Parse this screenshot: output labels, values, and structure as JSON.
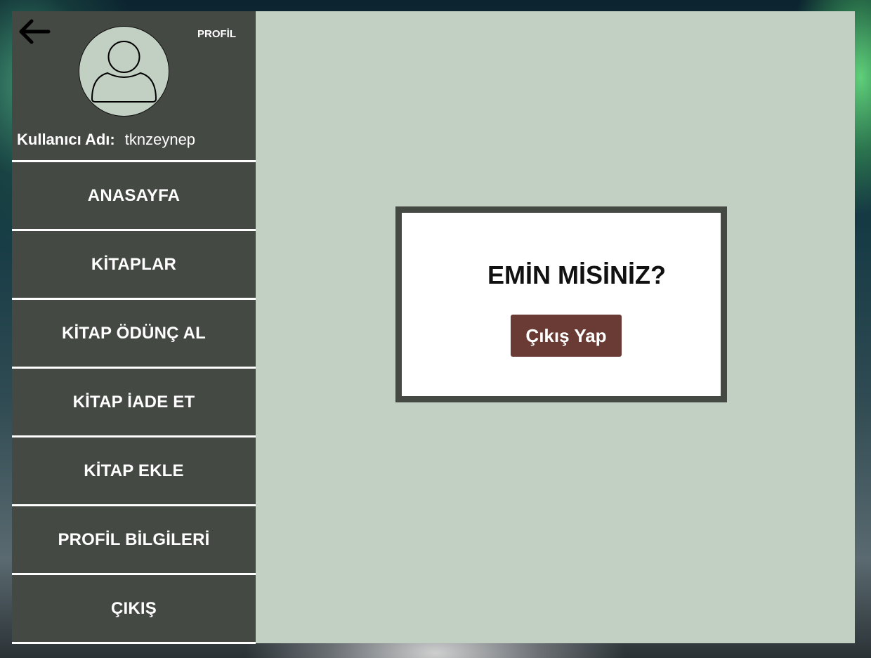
{
  "header": {
    "profile_label": "PROFİL"
  },
  "user": {
    "label": "Kullanıcı Adı:",
    "username": "tknzeynep"
  },
  "menu": {
    "items": [
      {
        "label": "ANASAYFA"
      },
      {
        "label": "KİTAPLAR"
      },
      {
        "label": "KİTAP ÖDÜNÇ AL"
      },
      {
        "label": "KİTAP İADE ET"
      },
      {
        "label": "KİTAP EKLE"
      },
      {
        "label": "PROFİL BİLGİLERİ"
      },
      {
        "label": "ÇIKIŞ"
      }
    ]
  },
  "dialog": {
    "title": "EMİN MİSİNİZ?",
    "confirm_label": "Çıkış Yap"
  },
  "colors": {
    "sidebar": "#454944",
    "content": "#c2d0c4",
    "button": "#6a3b34"
  },
  "icons": {
    "back": "arrow-left-icon",
    "avatar": "user-avatar-icon"
  }
}
